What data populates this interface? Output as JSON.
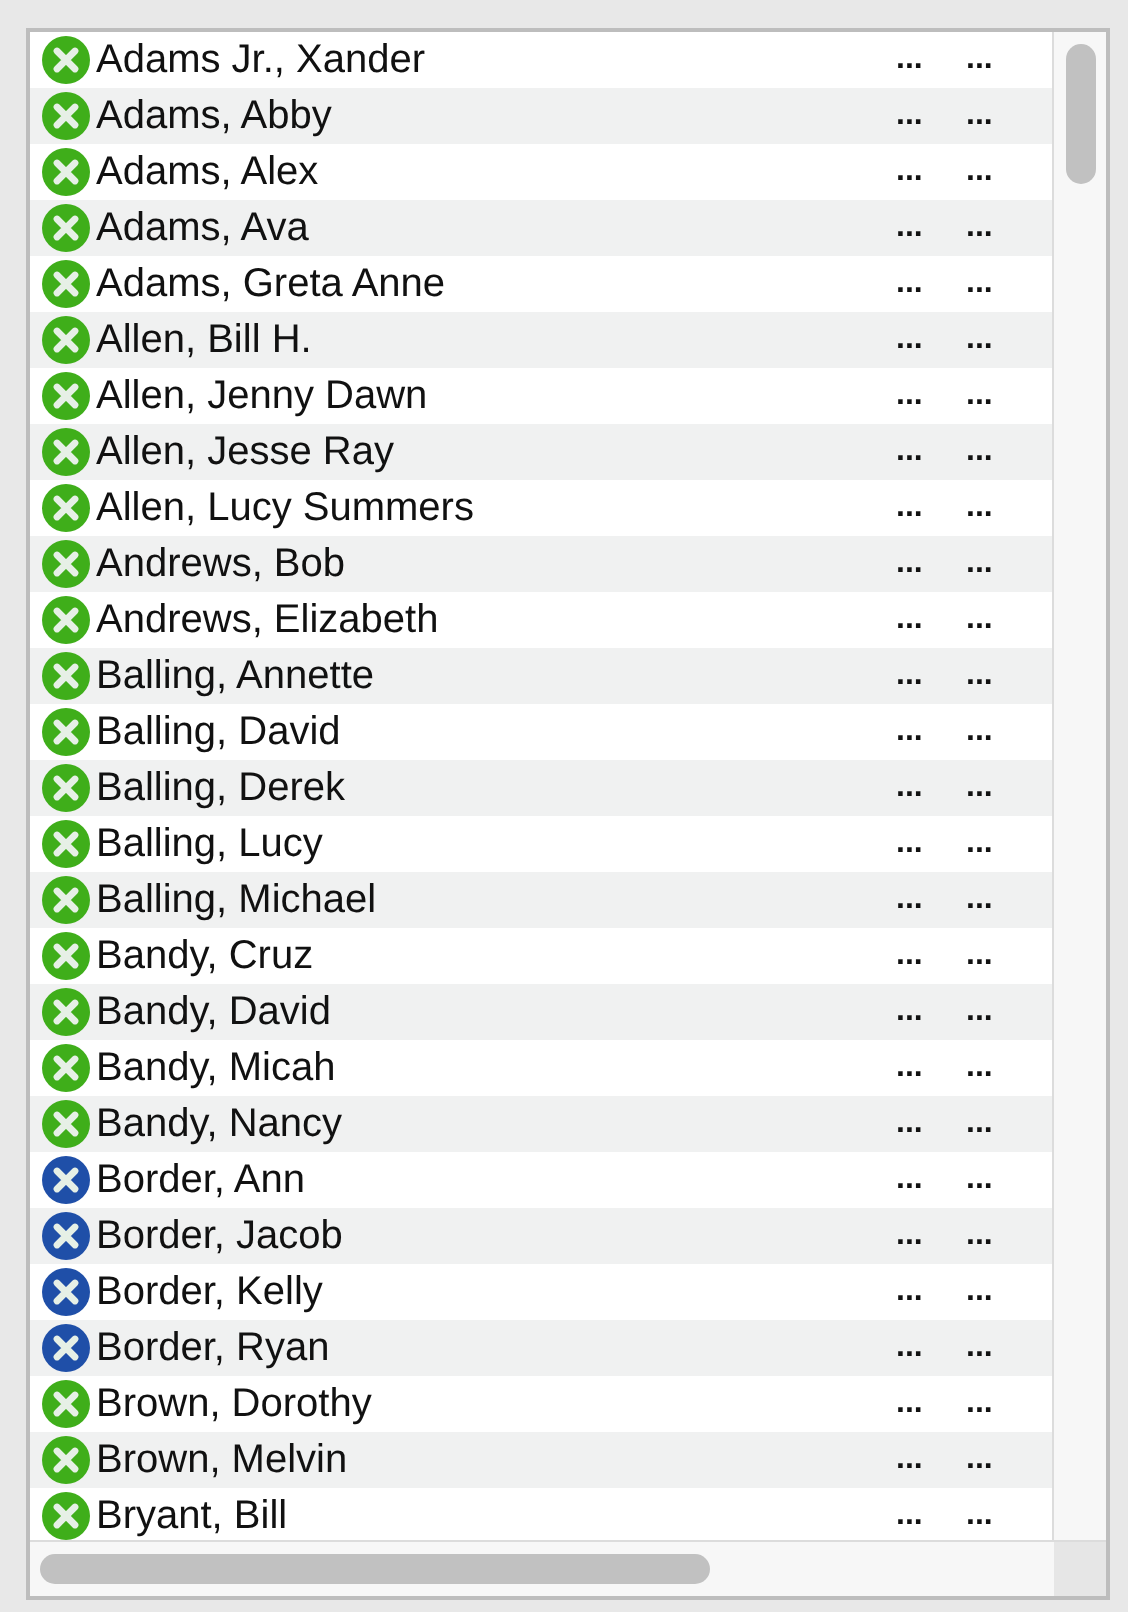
{
  "rows": [
    {
      "name": "Adams Jr., Xander",
      "color": "#3fae1a",
      "column_2": "...",
      "column_3": "..."
    },
    {
      "name": "Adams, Abby",
      "color": "#3fae1a",
      "column_2": "...",
      "column_3": "..."
    },
    {
      "name": "Adams, Alex",
      "color": "#3fae1a",
      "column_2": "...",
      "column_3": "..."
    },
    {
      "name": "Adams, Ava",
      "color": "#3fae1a",
      "column_2": "...",
      "column_3": "..."
    },
    {
      "name": "Adams, Greta Anne",
      "color": "#3fae1a",
      "column_2": "...",
      "column_3": "..."
    },
    {
      "name": "Allen, Bill H.",
      "color": "#3fae1a",
      "column_2": "...",
      "column_3": "..."
    },
    {
      "name": "Allen, Jenny Dawn",
      "color": "#3fae1a",
      "column_2": "...",
      "column_3": "..."
    },
    {
      "name": "Allen, Jesse Ray",
      "color": "#3fae1a",
      "column_2": "...",
      "column_3": "..."
    },
    {
      "name": "Allen, Lucy Summers",
      "color": "#3fae1a",
      "column_2": "...",
      "column_3": "..."
    },
    {
      "name": "Andrews, Bob",
      "color": "#3fae1a",
      "column_2": "...",
      "column_3": "..."
    },
    {
      "name": "Andrews, Elizabeth",
      "color": "#3fae1a",
      "column_2": "...",
      "column_3": "..."
    },
    {
      "name": "Balling, Annette",
      "color": "#3fae1a",
      "column_2": "...",
      "column_3": "..."
    },
    {
      "name": "Balling, David",
      "color": "#3fae1a",
      "column_2": "...",
      "column_3": "..."
    },
    {
      "name": "Balling, Derek",
      "color": "#3fae1a",
      "column_2": "...",
      "column_3": "..."
    },
    {
      "name": "Balling, Lucy",
      "color": "#3fae1a",
      "column_2": "...",
      "column_3": "..."
    },
    {
      "name": "Balling, Michael",
      "color": "#3fae1a",
      "column_2": "...",
      "column_3": "..."
    },
    {
      "name": "Bandy, Cruz",
      "color": "#3fae1a",
      "column_2": "...",
      "column_3": "..."
    },
    {
      "name": "Bandy, David",
      "color": "#3fae1a",
      "column_2": "...",
      "column_3": "..."
    },
    {
      "name": "Bandy, Micah",
      "color": "#3fae1a",
      "column_2": "...",
      "column_3": "..."
    },
    {
      "name": "Bandy, Nancy",
      "color": "#3fae1a",
      "column_2": "...",
      "column_3": "..."
    },
    {
      "name": "Border, Ann",
      "color": "#1f4fa8",
      "column_2": "...",
      "column_3": "..."
    },
    {
      "name": "Border, Jacob",
      "color": "#1f4fa8",
      "column_2": "...",
      "column_3": "..."
    },
    {
      "name": "Border, Kelly",
      "color": "#1f4fa8",
      "column_2": "...",
      "column_3": "..."
    },
    {
      "name": "Border, Ryan",
      "color": "#1f4fa8",
      "column_2": "...",
      "column_3": "..."
    },
    {
      "name": "Brown, Dorothy",
      "color": "#3fae1a",
      "column_2": "...",
      "column_3": "..."
    },
    {
      "name": "Brown, Melvin",
      "color": "#3fae1a",
      "column_2": "...",
      "column_3": "..."
    },
    {
      "name": "Bryant, Bill",
      "color": "#3fae1a",
      "column_2": "...",
      "column_3": "..."
    }
  ]
}
